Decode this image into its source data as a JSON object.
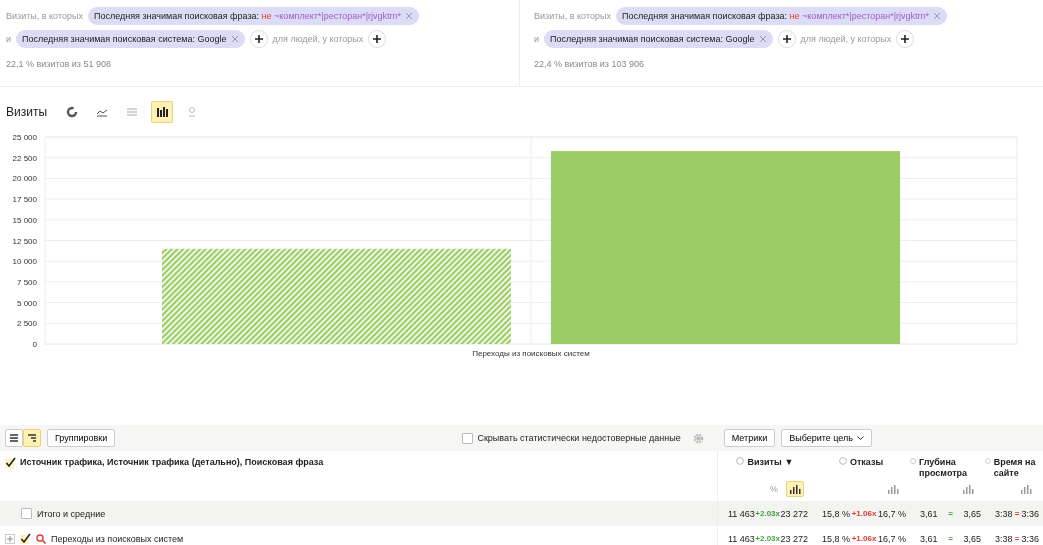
{
  "segments": [
    {
      "lead": "Визиты, в которых",
      "chip1": {
        "key": "Последняя значимая поисковая фраза:",
        "negation": "не",
        "value": "~комплект*|ресторан*|rjvgktrn*"
      },
      "joiner": "и",
      "chip2": "Последняя значимая поисковая система: Google",
      "people_label": "для людей, у которых",
      "share": "22,1 % визитов из 51 908"
    },
    {
      "lead": "Визиты, в которых",
      "chip1": {
        "key": "Последняя значимая поисковая фраза:",
        "negation": "не",
        "value": "~комплект*|ресторан*|rjvgktrn*"
      },
      "joiner": "и",
      "chip2": "Последняя значимая поисковая система: Google",
      "people_label": "для людей, у которых",
      "share": "22,4 % визитов из 103 906"
    }
  ],
  "chart_title": "Визиты",
  "chart_types": [
    {
      "kind": "pie",
      "selected": false
    },
    {
      "kind": "line",
      "selected": false
    },
    {
      "kind": "area",
      "selected": false
    },
    {
      "kind": "bar",
      "selected": true
    },
    {
      "kind": "map",
      "selected": false
    }
  ],
  "chart_data": {
    "type": "bar",
    "categories": [
      "Переходы из поисковых систем"
    ],
    "series": [
      {
        "color": "#9ccc65",
        "values": [
          11500
        ]
      },
      {
        "color": "#9ccc65",
        "values": [
          23300
        ]
      }
    ],
    "grid": true,
    "ylim": [
      0,
      25000
    ],
    "yticks": [
      {
        "value": 0,
        "label": "0"
      },
      {
        "value": 2500,
        "label": "2 500"
      },
      {
        "value": 5000,
        "label": "5 000"
      },
      {
        "value": 7500,
        "label": "7 500"
      },
      {
        "value": 10000,
        "label": "10 000"
      },
      {
        "value": 12500,
        "label": "12 500"
      },
      {
        "value": 15000,
        "label": "15 000"
      },
      {
        "value": 17500,
        "label": "17 500"
      },
      {
        "value": 20000,
        "label": "20 000"
      },
      {
        "value": 22500,
        "label": "22 500"
      },
      {
        "value": 25000,
        "label": "25 000"
      }
    ]
  },
  "table": {
    "view_modes": [
      {
        "kind": "list",
        "selected": false
      },
      {
        "kind": "tree",
        "selected": true
      }
    ],
    "groupings_button": "Группировки",
    "hide_unreliable": {
      "label": "Скрывать статистически недостоверные данные",
      "checked": false
    },
    "metrics_button": "Метрики",
    "goal_button": "Выберите цель",
    "dimension_header": {
      "label": "Источник трафика, Источник трафика (детально), Поисковая фраза",
      "checked": true
    },
    "columns": [
      {
        "label": "Визиты",
        "sort": "▼",
        "toggles": [
          {
            "kind": "percent",
            "label": "%",
            "selected": false
          },
          {
            "kind": "bars",
            "selected": true
          }
        ]
      },
      {
        "label": "Отказы",
        "toggles": [
          {
            "kind": "bars",
            "selected": false
          }
        ]
      },
      {
        "label": "Глубина просмотра",
        "toggles": [
          {
            "kind": "bars",
            "selected": false
          }
        ]
      },
      {
        "label": "Время на сайте",
        "toggles": [
          {
            "kind": "bars",
            "selected": false
          }
        ]
      }
    ],
    "rows": [
      {
        "kind": "total",
        "label": "Итого и средние",
        "checked": false,
        "cells": [
          {
            "a": "11 463",
            "delta": "+2.03x",
            "color": "#43a047",
            "b": "23 272"
          },
          {
            "a": "15,8 %",
            "delta": "+1.06x",
            "color": "#e53935",
            "b": "16,7 %"
          },
          {
            "a": "3,61",
            "delta": "=",
            "color": "#43a047",
            "b": "3,65"
          },
          {
            "a": "3:38",
            "delta": "=",
            "color": "#e53935",
            "b": "3:36"
          }
        ]
      },
      {
        "kind": "group",
        "label": "Переходы из поисковых систем",
        "checked": true,
        "expanded": false,
        "cells": [
          {
            "a": "11 463",
            "delta": "+2.03x",
            "color": "#43a047",
            "b": "23 272"
          },
          {
            "a": "15,8 %",
            "delta": "+1.06x",
            "color": "#e53935",
            "b": "16,7 %"
          },
          {
            "a": "3,61",
            "delta": "=",
            "color": "#43a047",
            "b": "3,65"
          },
          {
            "a": "3:38",
            "delta": "=",
            "color": "#e53935",
            "b": "3:36"
          }
        ]
      }
    ]
  }
}
